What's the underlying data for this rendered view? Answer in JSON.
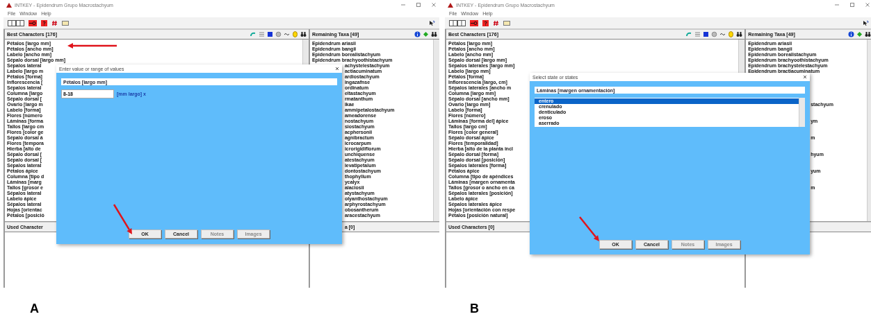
{
  "panels": [
    {
      "kind": "value",
      "letter": "A",
      "window": {
        "title": "INTKEY - Epidendrum Grupo Macrostachyum",
        "menu": [
          "File",
          "Window",
          "Help"
        ]
      },
      "best_characters": {
        "title": "Best Characters [176]",
        "items": [
          "Pétalos [largo mm]",
          "Pétalos [ancho mm]",
          "Labelo [ancho mm]",
          "Sépalo dorsal [largo mm]",
          "Sépalos lateral",
          "Labelo [largo m",
          "Pétalos [forma]",
          "Inflorescencia [",
          "Sépalos lateral",
          "Columna [largo",
          "Sépalo dorsal [",
          "Ovario [largo m",
          "Labelo [forma]",
          "Flores [número",
          "Láminas [forma",
          "Tallos [largo cm",
          "Flores [color ge",
          "Sépalo dorsal á",
          "Flores [tempora",
          "Hierba [alto de",
          "Sépalo dorsal [",
          "Sépalo dorsal [",
          "Sépalos lateral",
          "Pétalos ápice",
          "Columna [tipo d",
          "Láminas [marg",
          "Tallos [grosor e",
          "Sépalos lateral",
          "Labelo ápice",
          "Sépalos lateral",
          "Hojas [orientac",
          "Pétalos [posició"
        ]
      },
      "remaining_taxa": {
        "title": "Remaining Taxa [49]",
        "items": [
          {
            "label": "Epidendrum ariasii",
            "covered": false
          },
          {
            "label": "Epidendrum bangii",
            "covered": false
          },
          {
            "label": "Epidendrum borealistachyum",
            "covered": false
          },
          {
            "label": "Epidendrum brachyoothistachyum",
            "covered": false
          },
          {
            "label": "achystelestachyum",
            "covered": true
          },
          {
            "label": "actiacuminatum",
            "covered": true
          },
          {
            "label": "ardiostachyum",
            "covered": true
          },
          {
            "label": "ingazafnse",
            "covered": true
          },
          {
            "label": "ordinatum",
            "covered": true
          },
          {
            "label": "eltastachyum",
            "covered": true
          },
          {
            "label": "rmatanthum",
            "covered": true
          },
          {
            "label": "ikae",
            "covered": true
          },
          {
            "label": "ammipetalostachyum",
            "covered": true
          },
          {
            "label": "ameadorense",
            "covered": true
          },
          {
            "label": "nostachyum",
            "covered": true
          },
          {
            "label": "siostachyum",
            "covered": true
          },
          {
            "label": "acphersonii",
            "covered": true
          },
          {
            "label": "agnibractum",
            "covered": true
          },
          {
            "label": "icrocarpum",
            "covered": true
          },
          {
            "label": "icrorigidiflorum",
            "covered": true
          },
          {
            "label": "unchiquense",
            "covered": true
          },
          {
            "label": "atestachyum",
            "covered": true
          },
          {
            "label": "ievatipetalum",
            "covered": true
          },
          {
            "label": "dontostachyum",
            "covered": true
          },
          {
            "label": "thophyllum",
            "covered": true
          },
          {
            "label": "ycalyx",
            "covered": true
          },
          {
            "label": "alaciosii",
            "covered": true
          },
          {
            "label": "atystachyum",
            "covered": true
          },
          {
            "label": "olyanthostachyum",
            "covered": true
          },
          {
            "label": "arphyrostachyum",
            "covered": true
          },
          {
            "label": "obosantherum",
            "covered": true
          },
          {
            "label": "aracestachyum",
            "covered": true
          }
        ]
      },
      "used_characters": {
        "title": "Used Character"
      },
      "eliminated_taxa": {
        "title": "a [0]",
        "covered": true
      },
      "dialog": {
        "title": "Enter value or range of values",
        "character": "Pétalos [largo mm]",
        "value": "8-18",
        "unit": "[mm largo] x",
        "buttons": [
          {
            "label": "OK",
            "disabled": false
          },
          {
            "label": "Cancel",
            "disabled": false
          },
          {
            "label": "Notes",
            "disabled": true
          },
          {
            "label": "Images",
            "disabled": true
          }
        ]
      },
      "arrows": [
        {
          "kind": "list"
        },
        {
          "kind": "ok"
        }
      ]
    },
    {
      "kind": "states",
      "letter": "B",
      "window": {
        "title": "INTKEY - Epidendrum Grupo Macrostachyum",
        "menu": [
          "File",
          "Window",
          "Help"
        ]
      },
      "best_characters": {
        "title": "Best Characters [176]",
        "items": [
          "Pétalos [largo mm]",
          "Pétalos [ancho mm]",
          "Labelo [ancho mm]",
          "Sépalo dorsal [largo mm]",
          "Sépalos laterales [largo mm]",
          "Labelo [largo mm]",
          "Pétalos [forma]",
          "Inflorescencia [largo, cm]",
          "Sépalos laterales [ancho m",
          "Columna [largo mm]",
          "Sépalo dorsal [ancho mm]",
          "Ovario [largo mm]",
          "Labelo [forma]",
          "Flores [número]",
          "Láminas [forma del] ápice",
          "Tallos [largo cm]",
          "Flores [color general]",
          "Sépalo dorsal ápice",
          "Flores [temporalidad]",
          "Hierba [alto de la planta incl",
          "Sépalo dorsal [forma]",
          "Sépalo dorsal [posición]",
          "Sépalos laterales [forma]",
          "Pétalos ápice",
          "Columna [tipo de apéndices",
          "Láminas [margen ornamenta",
          "Tallos [grosor o ancho en ca",
          "Sépalos laterales [posición]",
          "Labelo ápice",
          "Sépalos laterales ápice",
          "Hojas [orientación con respe",
          "Pétalos [posición natural]"
        ]
      },
      "remaining_taxa": {
        "title": "Remaining Taxa [49]",
        "items": [
          {
            "label": "Epidendrum ariasii",
            "covered": false
          },
          {
            "label": "Epidendrum bangii",
            "covered": false
          },
          {
            "label": "Epidendrum borealistachyum",
            "covered": false
          },
          {
            "label": "Epidendrum brachyoothistachyum",
            "covered": false
          },
          {
            "label": "Epidendrum brachystelestachyum",
            "covered": false
          },
          {
            "label": "Epidendrum bractiacuminatum",
            "covered": false
          },
          {
            "label": "stachyum",
            "covered": true
          },
          {
            "label": "ym",
            "covered": true
          },
          {
            "label": "m",
            "covered": true
          },
          {
            "label": "hyum",
            "covered": true
          },
          {
            "label": "yum",
            "covered": true
          },
          {
            "label": "m",
            "covered": true
          }
        ]
      },
      "used_characters": {
        "title": "Used Characters [0]"
      },
      "dialog": {
        "title": "Select state or states",
        "character": "Láminas [margen ornamentación]",
        "states": [
          {
            "label": "entero",
            "selected": true
          },
          {
            "label": "crenulado",
            "selected": false
          },
          {
            "label": "denticulado",
            "selected": false
          },
          {
            "label": "eroso",
            "selected": false
          },
          {
            "label": "aserrado",
            "selected": false
          }
        ],
        "buttons": [
          {
            "label": "OK",
            "disabled": false
          },
          {
            "label": "Cancel",
            "disabled": false
          },
          {
            "label": "Notes",
            "disabled": true
          },
          {
            "label": "Images",
            "disabled": true
          }
        ]
      },
      "arrows": [
        {
          "kind": "ok"
        }
      ]
    }
  ]
}
